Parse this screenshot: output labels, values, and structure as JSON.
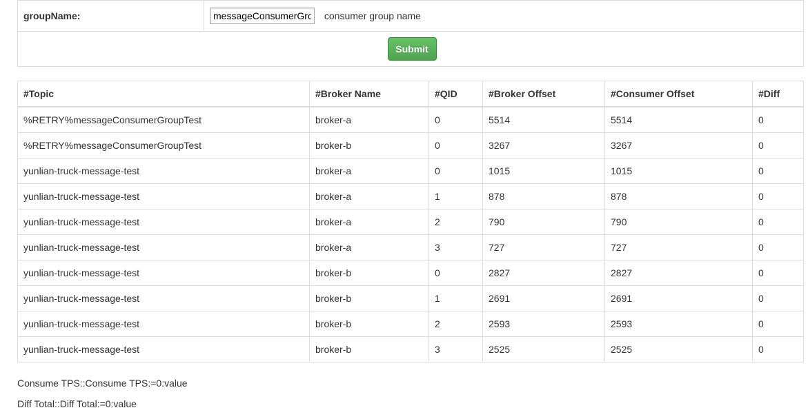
{
  "form": {
    "label": "groupName:",
    "input_value": "messageConsumerGroupTest",
    "hint": "consumer group name",
    "submit_label": "Submit"
  },
  "table": {
    "headers": [
      "#Topic",
      "#Broker Name",
      "#QID",
      "#Broker Offset",
      "#Consumer Offset",
      "#Diff"
    ],
    "rows": [
      [
        "%RETRY%messageConsumerGroupTest",
        "broker-a",
        "0",
        "5514",
        "5514",
        "0"
      ],
      [
        "%RETRY%messageConsumerGroupTest",
        "broker-b",
        "0",
        "3267",
        "3267",
        "0"
      ],
      [
        "yunlian-truck-message-test",
        "broker-a",
        "0",
        "1015",
        "1015",
        "0"
      ],
      [
        "yunlian-truck-message-test",
        "broker-a",
        "1",
        "878",
        "878",
        "0"
      ],
      [
        "yunlian-truck-message-test",
        "broker-a",
        "2",
        "790",
        "790",
        "0"
      ],
      [
        "yunlian-truck-message-test",
        "broker-a",
        "3",
        "727",
        "727",
        "0"
      ],
      [
        "yunlian-truck-message-test",
        "broker-b",
        "0",
        "2827",
        "2827",
        "0"
      ],
      [
        "yunlian-truck-message-test",
        "broker-b",
        "1",
        "2691",
        "2691",
        "0"
      ],
      [
        "yunlian-truck-message-test",
        "broker-b",
        "2",
        "2593",
        "2593",
        "0"
      ],
      [
        "yunlian-truck-message-test",
        "broker-b",
        "3",
        "2525",
        "2525",
        "0"
      ]
    ]
  },
  "stats": {
    "consume_tps": "Consume TPS::Consume TPS:=0:value",
    "diff_total": "Diff Total::Diff Total:=0:value"
  },
  "colors": {
    "button_green": "#5cb85c",
    "border": "#dddddd",
    "text": "#333333"
  }
}
